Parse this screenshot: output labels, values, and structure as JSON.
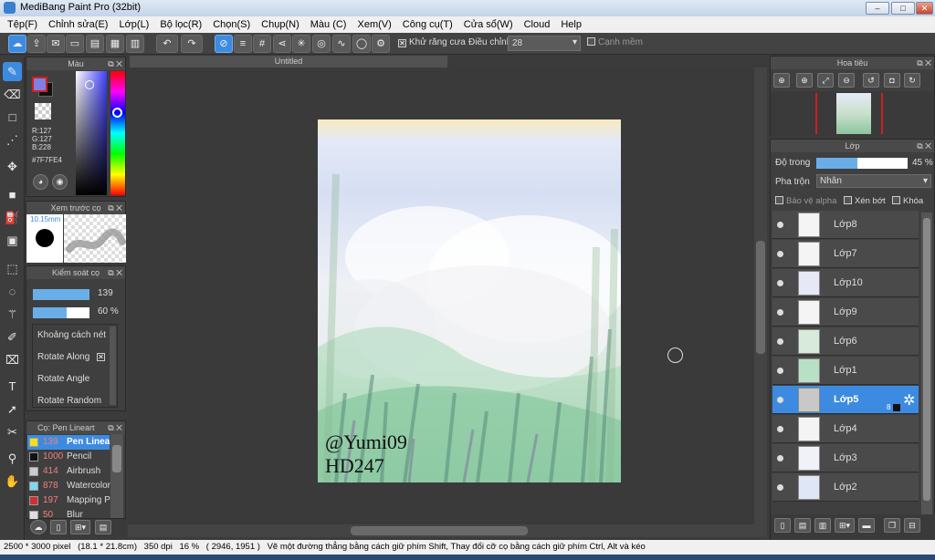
{
  "window": {
    "title": "MediBang Paint Pro (32bit)",
    "min_label": "–",
    "max_label": "□",
    "close_label": "✕"
  },
  "menu": [
    "Tệp(F)",
    "Chỉnh sửa(E)",
    "Lớp(L)",
    "Bộ lọc(R)",
    "Chọn(S)",
    "Chụp(N)",
    "Màu (C)",
    "Xem(V)",
    "Công cụ(T)",
    "Cửa sổ(W)",
    "Cloud",
    "Help"
  ],
  "toolbar": {
    "antialias_label": "Khử răng cưa",
    "adjust_label": "Điều chỉnh",
    "brush_size": "28",
    "smooth_label": "Cạnh mềm"
  },
  "color_panel": {
    "title": "Màu",
    "r": "R:127",
    "g": "G:127",
    "b": "B:228",
    "hex": "#7F7FE4",
    "fg": "#7F7FE4",
    "bg": "#111111"
  },
  "preview_panel": {
    "title": "Xem trước cọ",
    "size": "10.15mm"
  },
  "brush_control": {
    "title": "Kiểm soát cọ",
    "size_value": "139",
    "opacity_value": "60 %",
    "size_fill": 0.82,
    "opacity_fill": 0.6,
    "rows": [
      "Khoảng cách nét",
      "Rotate Along",
      "Rotate Angle",
      "Rotate Random"
    ]
  },
  "brush_list": {
    "title": "Cọ: Pen Lineart",
    "items": [
      {
        "size": "139",
        "name": "Pen Lineart",
        "color": "#f0e020",
        "selected": true
      },
      {
        "size": "1000",
        "name": "Pencil",
        "color": "#111111",
        "selected": false
      },
      {
        "size": "414",
        "name": "Airbrush",
        "color": "#cccccc",
        "selected": false
      },
      {
        "size": "878",
        "name": "Watercolor",
        "color": "#80d8f0",
        "selected": false
      },
      {
        "size": "197",
        "name": "Mapping Pen",
        "color": "#d03030",
        "selected": false
      },
      {
        "size": "50",
        "name": "Blur",
        "color": "#dddddd",
        "selected": false
      }
    ]
  },
  "document": {
    "tab_title": "Untitled",
    "watermark_line1": "@Yumi09",
    "watermark_line2": "HD247"
  },
  "navigator": {
    "title": "Hoa tiêu"
  },
  "layers_panel": {
    "title": "Lớp",
    "opacity_label": "Độ trong",
    "opacity_value": "45 %",
    "opacity_fill": 0.45,
    "blend_label": "Pha trộn",
    "blend_value": "Nhân",
    "protect_alpha": "Bảo vệ alpha",
    "clip": "Xén bớt",
    "lock": "Khóa",
    "selected_badge": "8"
  },
  "layers": [
    {
      "name": "Lớp8",
      "selected": false,
      "thumb": "#f4f4f4"
    },
    {
      "name": "Lớp7",
      "selected": false,
      "thumb": "#f4f4f4"
    },
    {
      "name": "Lớp10",
      "selected": false,
      "thumb": "#e6e8f6"
    },
    {
      "name": "Lớp9",
      "selected": false,
      "thumb": "#f4f4f4"
    },
    {
      "name": "Lớp6",
      "selected": false,
      "thumb": "#d8eadb"
    },
    {
      "name": "Lớp1",
      "selected": false,
      "thumb": "#b8e0c4"
    },
    {
      "name": "Lớp5",
      "selected": true,
      "thumb": "#c8c8c8"
    },
    {
      "name": "Lớp4",
      "selected": false,
      "thumb": "#f4f4f4"
    },
    {
      "name": "Lớp3",
      "selected": false,
      "thumb": "#f0f2f8"
    },
    {
      "name": "Lớp2",
      "selected": false,
      "thumb": "#dfe6f6"
    }
  ],
  "status": {
    "size": "2500 * 3000 pixel",
    "physical": "(18.1 * 21.8cm)",
    "dpi": "350 dpi",
    "zoom": "16 %",
    "coords": "( 2946, 1951 )",
    "hint": "Vẽ một đường thẳng bằng cách giữ phím Shift, Thay đổi cỡ cọ bằng cách giữ phím Ctrl, Alt và kéo"
  },
  "colors": {
    "accent": "#3d8be0"
  }
}
